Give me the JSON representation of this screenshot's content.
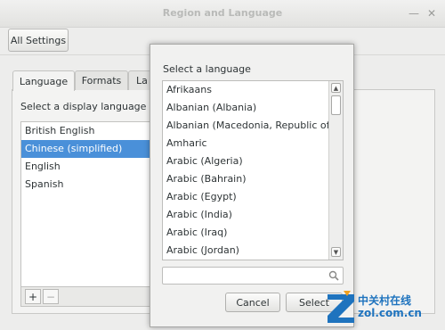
{
  "window": {
    "title": "Region and Language"
  },
  "toolbar": {
    "all_settings": "All Settings"
  },
  "tabs": [
    {
      "label": "Language"
    },
    {
      "label": "Formats"
    },
    {
      "label": "La"
    }
  ],
  "language_panel": {
    "prompt": "Select a display language (char",
    "languages": [
      "British English",
      "Chinese (simplified)",
      "English",
      "Spanish"
    ],
    "selected_index": 1,
    "add_label": "+",
    "remove_label": "−"
  },
  "dialog": {
    "label": "Select a language",
    "languages": [
      "Afrikaans",
      "Albanian (Albania)",
      "Albanian (Macedonia, Republic of)",
      "Amharic",
      "Arabic (Algeria)",
      "Arabic (Bahrain)",
      "Arabic (Egypt)",
      "Arabic (India)",
      "Arabic (Iraq)",
      "Arabic (Jordan)"
    ],
    "search_placeholder": "",
    "cancel_label": "Cancel",
    "select_label": "Select"
  },
  "watermark": {
    "cn": "中关村在线",
    "url": "zol.com.cn"
  },
  "colors": {
    "selection": "#4a90d9",
    "watermark": "#1e73be"
  }
}
